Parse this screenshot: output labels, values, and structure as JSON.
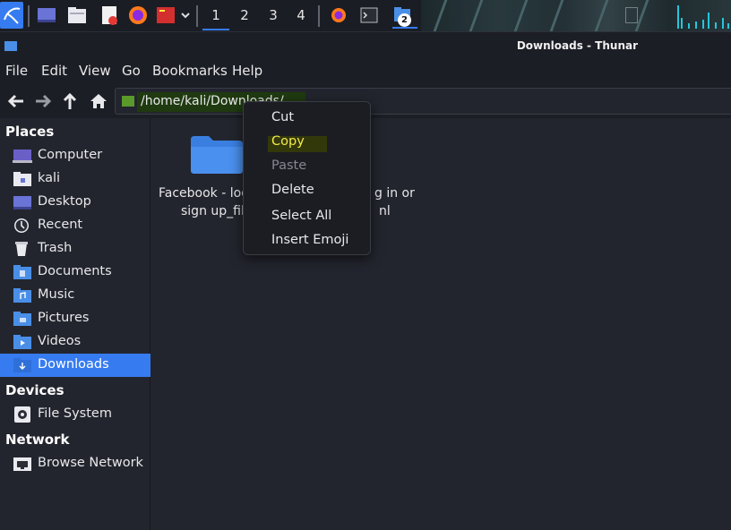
{
  "panel": {
    "workspaces": [
      "1",
      "2",
      "3",
      "4"
    ],
    "active_workspace": "1",
    "task_badge": "2"
  },
  "window": {
    "title": "Downloads - Thunar"
  },
  "menu": [
    "File",
    "Edit",
    "View",
    "Go",
    "Bookmarks",
    "Help"
  ],
  "location": {
    "path": "/home/kali/Downloads/"
  },
  "sidebar": {
    "places_header": "Places",
    "places": [
      {
        "label": "Computer",
        "icon": "computer-icon"
      },
      {
        "label": "kali",
        "icon": "home-folder-icon"
      },
      {
        "label": "Desktop",
        "icon": "desktop-icon"
      },
      {
        "label": "Recent",
        "icon": "recent-icon"
      },
      {
        "label": "Trash",
        "icon": "trash-icon"
      },
      {
        "label": "Documents",
        "icon": "documents-folder-icon"
      },
      {
        "label": "Music",
        "icon": "music-folder-icon"
      },
      {
        "label": "Pictures",
        "icon": "pictures-folder-icon"
      },
      {
        "label": "Videos",
        "icon": "videos-folder-icon"
      },
      {
        "label": "Downloads",
        "icon": "downloads-folder-icon",
        "selected": true
      }
    ],
    "devices_header": "Devices",
    "devices": [
      {
        "label": "File System",
        "icon": "drive-icon"
      }
    ],
    "network_header": "Network",
    "network": [
      {
        "label": "Browse Network",
        "icon": "network-icon"
      }
    ]
  },
  "file": {
    "line1_left": "Facebook - log",
    "line1_right": "g in or",
    "line2_left": "sign up_file",
    "line2_right": "nl"
  },
  "context_menu": {
    "items": [
      "Cut",
      "Copy",
      "Paste",
      "Delete",
      "Select All",
      "Insert Emoji"
    ],
    "disabled": [
      "Paste"
    ],
    "highlighted": "Copy"
  },
  "colors": {
    "accent": "#367bf0",
    "background": "#23252e",
    "highlight": "#f2e94e"
  }
}
